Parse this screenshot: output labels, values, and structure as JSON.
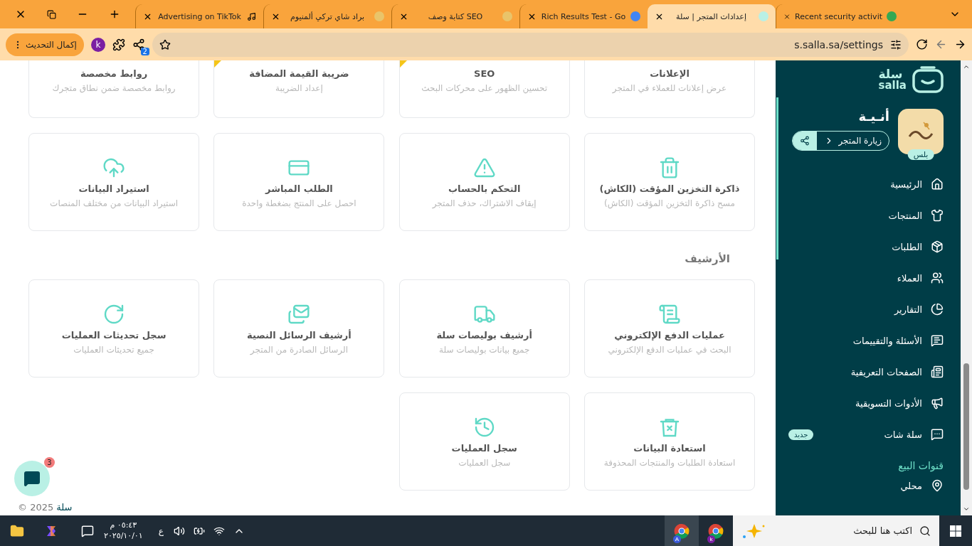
{
  "browser": {
    "tabs": [
      {
        "title": "Recent security activit",
        "selected": false
      },
      {
        "title": "إعدادات المتجر | سلة",
        "selected": true
      },
      {
        "title": "Rich Results Test - Go",
        "selected": false
      },
      {
        "title": "كتابة وصف SEO",
        "selected": false
      },
      {
        "title": "براد شاي تركي ألمنيوم",
        "selected": false
      },
      {
        "title": "Advertising on TikTok",
        "selected": false
      }
    ],
    "update_button": "إكمال التحديث",
    "profile_initial": "k",
    "extension_badge": "2",
    "url": "s.salla.sa/settings"
  },
  "settings": {
    "rows": [
      [
        {
          "title": "الإعلانات",
          "subtitle": "عرض إعلانات للعملاء في المتجر",
          "corner_tag": false
        },
        {
          "title": "SEO",
          "subtitle": "تحسين الظهور على محركات البحث",
          "corner_tag": true
        },
        {
          "title": "ضريبة القيمة المضافة",
          "subtitle": "إعداد الضريبة",
          "corner_tag": true
        },
        {
          "title": "روابط مخصصة",
          "subtitle": "روابط مخصصة ضمن نطاق متجرك",
          "corner_tag": false
        }
      ],
      [
        {
          "title": "ذاكرة التخزين المؤقت (الكاش)",
          "subtitle": "مسح ذاكرة التخزين المؤقت (الكاش)",
          "corner_tag": false
        },
        {
          "title": "التحكم بالحساب",
          "subtitle": "إيقاف الاشتراك، حذف المتجر",
          "corner_tag": false
        },
        {
          "title": "الطلب المباشر",
          "subtitle": "احصل على المنتج بضغطة واحدة",
          "corner_tag": false
        },
        {
          "title": "استيراد البيانات",
          "subtitle": "استيراد البيانات من مختلف المنصات",
          "corner_tag": false
        }
      ]
    ]
  },
  "archive": {
    "title": "الأرشيف",
    "cards": [
      {
        "title": "عمليات الدفع الإلكتروني",
        "subtitle": "البحث في عمليات الدفع الإلكتروني"
      },
      {
        "title": "أرشيف بوليصات سلة",
        "subtitle": "جميع بيانات بوليصات سلة"
      },
      {
        "title": "أرشيف الرسائل النصية",
        "subtitle": "الرسائل الصادرة من المتجر"
      },
      {
        "title": "سجل تحديثات العمليات",
        "subtitle": "جميع تحديثات العمليات"
      },
      {
        "title": "استعادة البيانات",
        "subtitle": "استعادة الطلبات والمنتجات المحذوفة"
      },
      {
        "title": "سجل العمليات",
        "subtitle": "سجل العمليات"
      }
    ]
  },
  "chat_widget": {
    "badge": "3"
  },
  "footer": {
    "brand": "سلة",
    "copyright": "© 2025"
  },
  "sidebar": {
    "logo_ar": "سلة",
    "logo_en": "salla",
    "store_name": "أنـيـة",
    "plan_badge": "بلس",
    "visit_button": "زيارة المتجر",
    "menu": [
      {
        "label": "الرئيسية"
      },
      {
        "label": "المنتجات"
      },
      {
        "label": "الطلبات"
      },
      {
        "label": "العملاء"
      },
      {
        "label": "التقارير"
      },
      {
        "label": "الأسئلة والتقييمات"
      },
      {
        "label": "الصفحات التعريفية"
      },
      {
        "label": "الأدوات التسويقية"
      },
      {
        "label": "سلة شات",
        "badge": "جديد"
      }
    ],
    "section_title": "قنوات البيع",
    "channels": [
      {
        "label": "محلي"
      }
    ]
  },
  "taskbar": {
    "time": "٠٥:٤٣ م",
    "date": "٢٠٢٥/١٠/٠١",
    "language": "ع",
    "search_placeholder": "اكتب هنا للبحث",
    "chrome_profiles": [
      "k",
      "A"
    ]
  }
}
